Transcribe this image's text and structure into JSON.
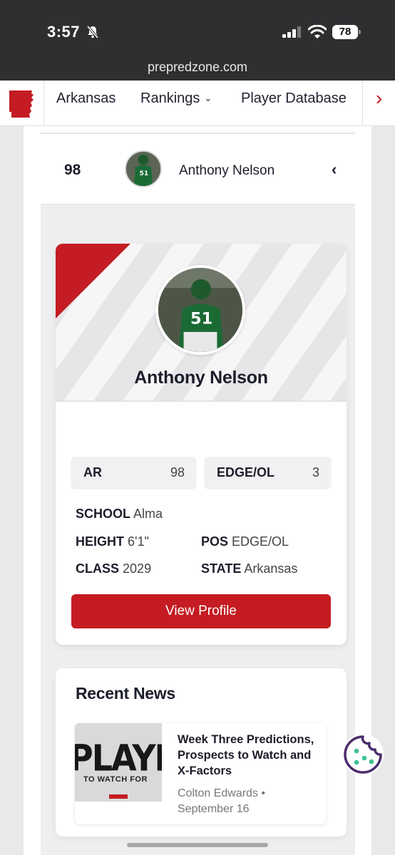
{
  "status_bar": {
    "time": "3:57",
    "battery": "78",
    "url": "prepredzone.com"
  },
  "nav": {
    "logo_icon": "arkansas-state-icon",
    "items": [
      {
        "label": "Arkansas"
      },
      {
        "label": "Rankings"
      },
      {
        "label": "Player Database"
      }
    ],
    "accent": "#c41c22"
  },
  "rank_row": {
    "rank": "98",
    "name": "Anthony Nelson"
  },
  "player_card": {
    "name": "Anthony Nelson",
    "jersey": "51",
    "stats": [
      {
        "label": "AR",
        "value": "98"
      },
      {
        "label": "EDGE/OL",
        "value": "3"
      }
    ],
    "info": {
      "school_label": "SCHOOL",
      "school": "Alma",
      "height_label": "HEIGHT",
      "height": "6'1\"",
      "pos_label": "POS",
      "pos": "EDGE/OL",
      "class_label": "CLASS",
      "class": "2029",
      "state_label": "STATE",
      "state": "Arkansas"
    },
    "button_label": "View Profile"
  },
  "recent_news": {
    "title": "Recent News",
    "items": [
      {
        "thumbnail_big": "PLAYERS",
        "thumbnail_small": "TO WATCH FOR",
        "headline": "Week Three Predictions, Prospects to Watch and X-Factors",
        "author": "Colton Edwards",
        "separator": "•",
        "date": "September 16"
      }
    ]
  },
  "colors": {
    "brand_red": "#c41c22",
    "top_bar": "#2e2f31",
    "cookie_purple": "#4a2c6b",
    "cookie_green": "#3ec28f"
  }
}
